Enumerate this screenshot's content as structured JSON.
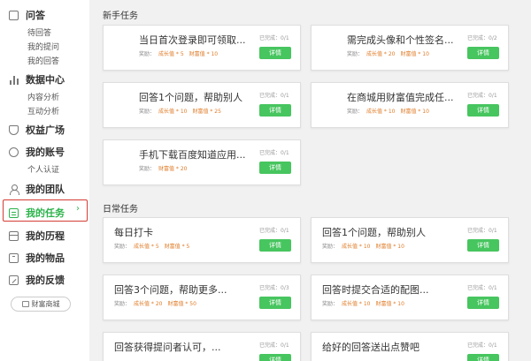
{
  "sidebar": {
    "qa": {
      "title": "问答",
      "items": [
        "待回答",
        "我的提问",
        "我的回答"
      ]
    },
    "data_center": {
      "title": "数据中心",
      "items": [
        "内容分析",
        "互动分析"
      ]
    },
    "rights_plaza": "权益广场",
    "account": {
      "title": "我的账号",
      "items": [
        "个人认证"
      ]
    },
    "team": "我的团队",
    "tasks": "我的任务",
    "history": "我的历程",
    "items": "我的物品",
    "feedback": "我的反馈",
    "mall_button": "财富商城"
  },
  "sections": {
    "newbie_title": "新手任务",
    "daily_title": "日常任务"
  },
  "common": {
    "reward_label": "奖励：",
    "details_button": "详情"
  },
  "newbie_tasks": [
    {
      "title": "当日首次登录即可领取...",
      "growth": "成长值 * 5",
      "wealth": "财富值 * 10",
      "status": "已完成：0/1"
    },
    {
      "title": "需完成头像和个性签名...",
      "growth": "成长值 * 20",
      "wealth": "财富值 * 10",
      "status": "已完成：0/2"
    },
    {
      "title": "回答1个问题，帮助别人",
      "growth": "成长值 * 10",
      "wealth": "财富值 * 25",
      "status": "已完成：0/1"
    },
    {
      "title": "在商城用财富值完成任...",
      "growth": "成长值 * 10",
      "wealth": "财富值 * 10",
      "status": "已完成：0/1"
    },
    {
      "title": "手机下载百度知道应用...",
      "growth": "",
      "wealth": "财富值 * 20",
      "status": "已完成：0/1"
    }
  ],
  "daily_tasks": [
    {
      "title": "每日打卡",
      "growth": "成长值 * 5",
      "wealth": "财富值 * 5",
      "status": "已完成：0/1"
    },
    {
      "title": "回答1个问题，帮助别人",
      "growth": "成长值 * 10",
      "wealth": "财富值 * 10",
      "status": "已完成：0/1"
    },
    {
      "title": "回答3个问题，帮助更多...",
      "growth": "成长值 * 20",
      "wealth": "财富值 * 50",
      "status": "已完成：0/3"
    },
    {
      "title": "回答时提交合适的配图...",
      "growth": "成长值 * 10",
      "wealth": "财富值 * 10",
      "status": "已完成：0/1"
    },
    {
      "title": "回答获得提问者认可，...",
      "growth": "",
      "wealth": "",
      "status": "已完成：0/1"
    },
    {
      "title": "给好的回答送出点赞吧",
      "growth": "",
      "wealth": "",
      "status": "已完成：0/1"
    }
  ]
}
